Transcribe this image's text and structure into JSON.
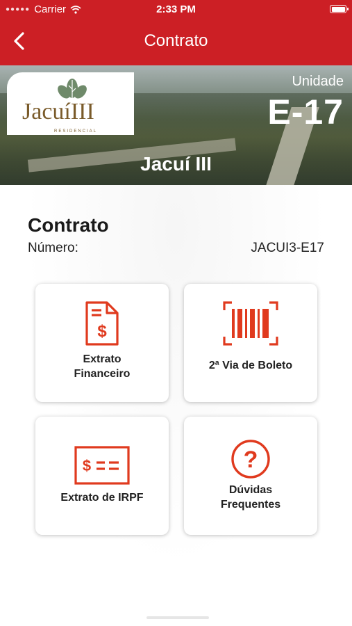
{
  "status_bar": {
    "carrier": "Carrier",
    "time": "2:33 PM"
  },
  "nav": {
    "title": "Contrato"
  },
  "hero": {
    "logo_text": "JacuíIII",
    "logo_subtext": "RESIDENCIAL",
    "unit_label": "Unidade",
    "unit_value": "E-17",
    "development_name": "Jacuí III"
  },
  "contract": {
    "title": "Contrato",
    "number_label": "Número:",
    "number_value": "JACUI3-E17"
  },
  "actions": [
    {
      "label_line1": "Extrato",
      "label_line2": "Financeiro",
      "icon": "document-dollar-icon"
    },
    {
      "label_line1": "2ª Via de Boleto",
      "icon": "barcode-icon"
    },
    {
      "label_line1": "Extrato de IRPF",
      "icon": "card-dollar-icon"
    },
    {
      "label_line1": "Dúvidas",
      "label_line2": "Frequentes",
      "icon": "question-circle-icon"
    }
  ],
  "colors": {
    "brand_red": "#cc1f25",
    "icon_orange": "#e03a1e",
    "logo_brown": "#7a5b2a"
  }
}
